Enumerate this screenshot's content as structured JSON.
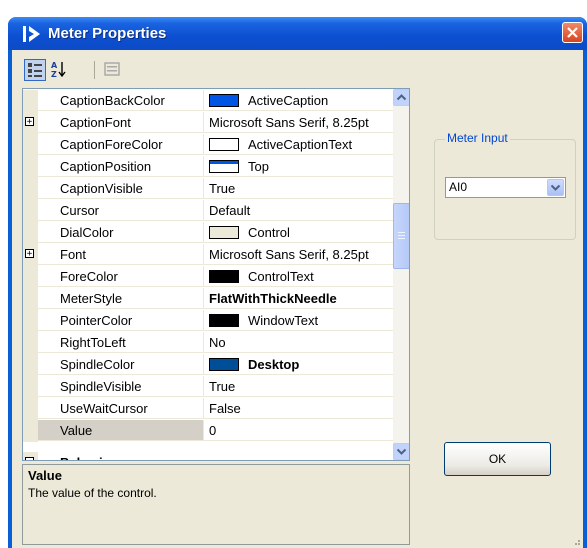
{
  "window": {
    "title": "Meter Properties",
    "accent_color": "#0a5ed6",
    "close_color": "#d8431f"
  },
  "toolbar": {
    "buttons": [
      {
        "name": "categorized",
        "icon": "categorized-icon",
        "active": true
      },
      {
        "name": "alphabetical",
        "icon": "sort-az-icon",
        "active": false
      },
      {
        "name": "property-pages",
        "icon": "property-pages-icon",
        "active": false
      }
    ]
  },
  "properties": {
    "rows": [
      {
        "name": "CaptionBackColor",
        "value": "ActiveCaption",
        "swatch": "caption",
        "expandable": false,
        "bold": false
      },
      {
        "name": "CaptionFont",
        "value": "Microsoft Sans Serif, 8.25pt",
        "swatch": "",
        "expandable": true,
        "bold": false
      },
      {
        "name": "CaptionForeColor",
        "value": "ActiveCaptionText",
        "swatch": "white",
        "expandable": false,
        "bold": false
      },
      {
        "name": "CaptionPosition",
        "value": "Top",
        "swatch": "top",
        "expandable": false,
        "bold": false
      },
      {
        "name": "CaptionVisible",
        "value": "True",
        "swatch": "",
        "expandable": false,
        "bold": false
      },
      {
        "name": "Cursor",
        "value": "Default",
        "swatch": "",
        "expandable": false,
        "bold": false
      },
      {
        "name": "DialColor",
        "value": "Control",
        "swatch": "control",
        "expandable": false,
        "bold": false
      },
      {
        "name": "Font",
        "value": "Microsoft Sans Serif, 8.25pt",
        "swatch": "",
        "expandable": true,
        "bold": false
      },
      {
        "name": "ForeColor",
        "value": "ControlText",
        "swatch": "black",
        "expandable": false,
        "bold": false
      },
      {
        "name": "MeterStyle",
        "value": "FlatWithThickNeedle",
        "swatch": "",
        "expandable": false,
        "bold": true
      },
      {
        "name": "PointerColor",
        "value": "WindowText",
        "swatch": "black",
        "expandable": false,
        "bold": false
      },
      {
        "name": "RightToLeft",
        "value": "No",
        "swatch": "",
        "expandable": false,
        "bold": false
      },
      {
        "name": "SpindleColor",
        "value": "Desktop",
        "swatch": "desktop",
        "expandable": false,
        "bold": true
      },
      {
        "name": "SpindleVisible",
        "value": "True",
        "swatch": "",
        "expandable": false,
        "bold": false
      },
      {
        "name": "UseWaitCursor",
        "value": "False",
        "swatch": "",
        "expandable": false,
        "bold": false
      },
      {
        "name": "Value",
        "value": "0",
        "swatch": "",
        "expandable": false,
        "bold": false,
        "selected": true
      }
    ],
    "category": "Behavior"
  },
  "description": {
    "title": "Value",
    "text": "The value of the control."
  },
  "meter_input": {
    "label": "Meter Input",
    "selected": "AI0"
  },
  "ok_button": {
    "label": "OK"
  }
}
